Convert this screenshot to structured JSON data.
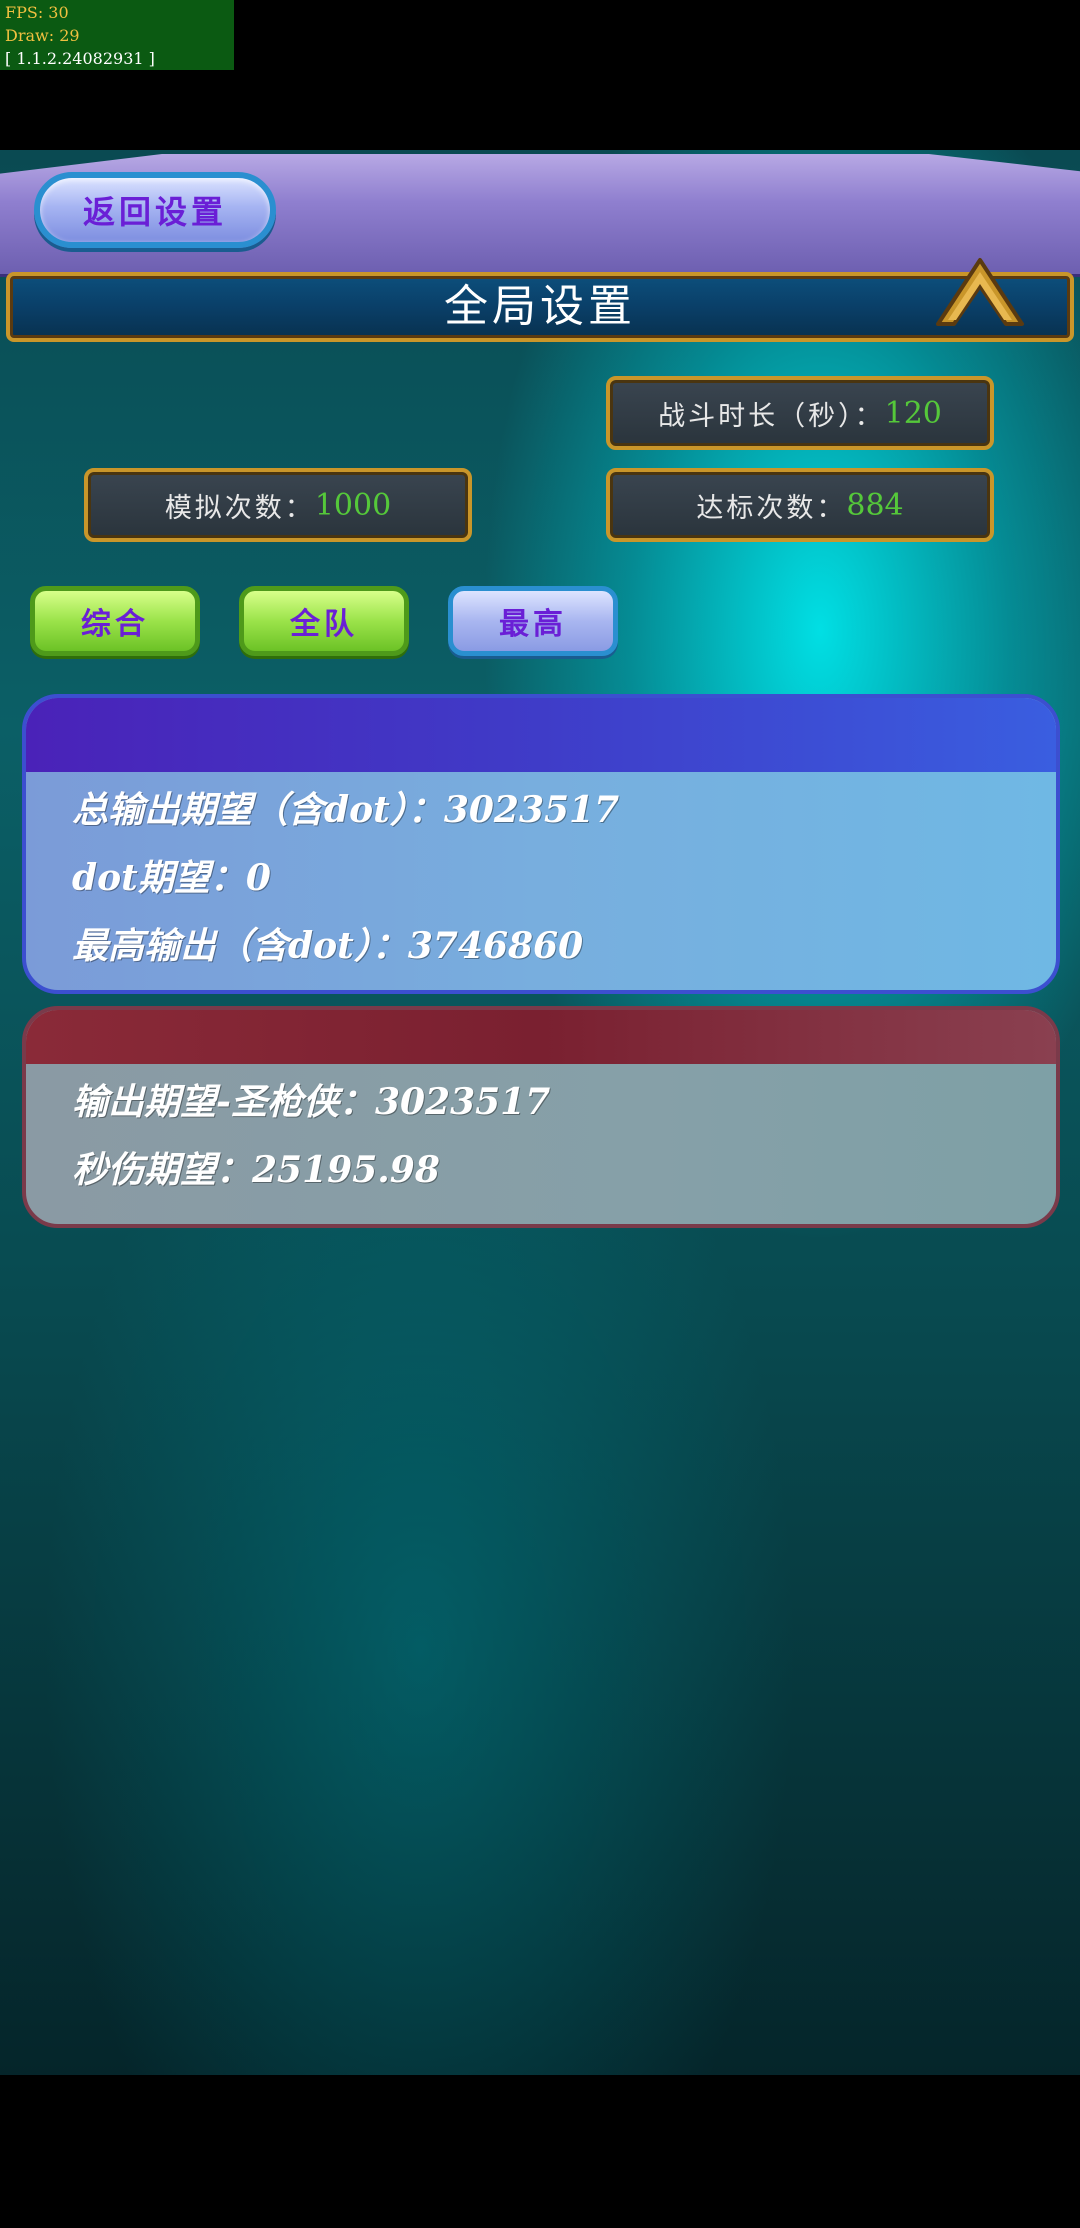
{
  "debug": {
    "fps": "FPS: 30",
    "draw": "Draw: 29",
    "version": "[ 1.1.2.24082931 ]"
  },
  "header": {
    "back_label": "返回设置",
    "title": "全局设置"
  },
  "settings": {
    "battle_duration_label": "战斗时长（秒）：",
    "battle_duration_value": "120",
    "simulations_label": "模拟次数：",
    "simulations_value": "1000",
    "target_reached_label": "达标次数：",
    "target_reached_value": "884"
  },
  "tabs": [
    {
      "label": "综合",
      "style": "green"
    },
    {
      "label": "全队",
      "style": "green"
    },
    {
      "label": "最高",
      "style": "blue"
    }
  ],
  "summary_panel": {
    "lines": [
      "总输出期望（含dot）：3023517",
      "dot期望：0",
      "最高输出（含dot）：3746860"
    ]
  },
  "character_panel": {
    "lines": [
      "输出期望-圣枪侠：3023517",
      "秒伤期望：25195.98"
    ]
  },
  "colors": {
    "value_green": "#55c83a",
    "tab_text": "#6a1fd6",
    "frame_gold": "#c9962a"
  },
  "icons": {
    "collapse": "chevron-up-icon"
  }
}
